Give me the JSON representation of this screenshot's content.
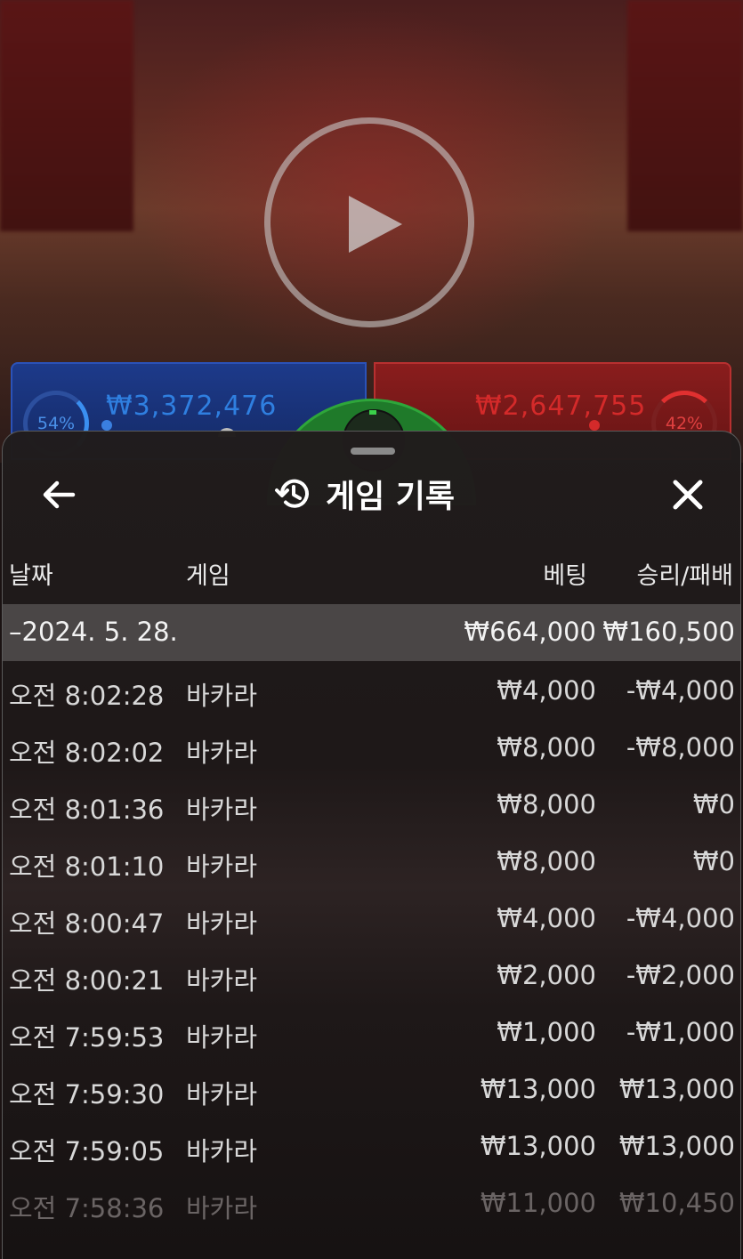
{
  "video": {
    "blue_amount": "₩3,372,476",
    "blue_percent": "54%",
    "red_amount": "₩2,647,755",
    "red_percent": "42%",
    "play_icon": "play-icon"
  },
  "sheet": {
    "title": "게임 기록",
    "title_icon": "history-icon",
    "back_icon": "arrow-left-icon",
    "close_icon": "close-icon"
  },
  "table": {
    "headers": {
      "date": "날짜",
      "game": "게임",
      "bet": "베팅",
      "result": "승리/패배"
    },
    "group": {
      "date": "–2024. 5. 28.",
      "bet_total": "₩664,000",
      "result_total": "₩160,500"
    },
    "rows": [
      {
        "time": "오전 8:02:28",
        "game": "바카라",
        "bet": "₩4,000",
        "result": "-₩4,000"
      },
      {
        "time": "오전 8:02:02",
        "game": "바카라",
        "bet": "₩8,000",
        "result": "-₩8,000"
      },
      {
        "time": "오전 8:01:36",
        "game": "바카라",
        "bet": "₩8,000",
        "result": "₩0"
      },
      {
        "time": "오전 8:01:10",
        "game": "바카라",
        "bet": "₩8,000",
        "result": "₩0"
      },
      {
        "time": "오전 8:00:47",
        "game": "바카라",
        "bet": "₩4,000",
        "result": "-₩4,000"
      },
      {
        "time": "오전 8:00:21",
        "game": "바카라",
        "bet": "₩2,000",
        "result": "-₩2,000"
      },
      {
        "time": "오전 7:59:53",
        "game": "바카라",
        "bet": "₩1,000",
        "result": "-₩1,000"
      },
      {
        "time": "오전 7:59:30",
        "game": "바카라",
        "bet": "₩13,000",
        "result": "₩13,000"
      },
      {
        "time": "오전 7:59:05",
        "game": "바카라",
        "bet": "₩13,000",
        "result": "₩13,000"
      },
      {
        "time": "오전 7:58:36",
        "game": "바카라",
        "bet": "₩11,000",
        "result": "₩10,450"
      }
    ]
  }
}
